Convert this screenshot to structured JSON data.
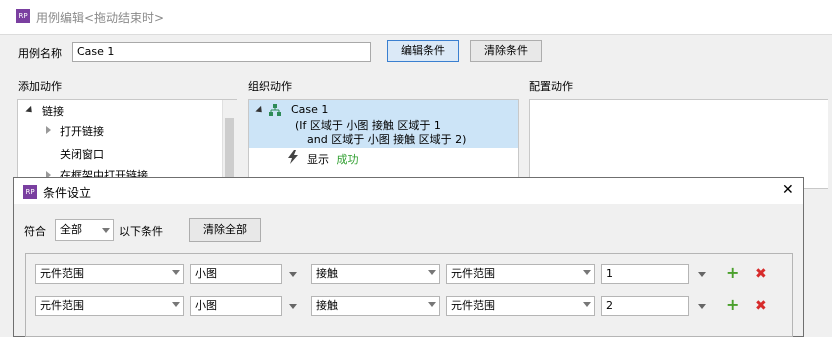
{
  "window": {
    "title": "用例编辑<拖动结束时>",
    "logo": "RP"
  },
  "case_name": {
    "label": "用例名称",
    "value": "Case 1"
  },
  "toolbar": {
    "edit_condition": "编辑条件",
    "clear_condition": "清除条件"
  },
  "sections": {
    "add_action": "添加动作",
    "organize_action": "组织动作",
    "configure_action": "配置动作"
  },
  "add_action_tree": {
    "link_group": "链接",
    "items": [
      "打开链接",
      "关闭窗口",
      "在框架中打开链接"
    ]
  },
  "organize_tree": {
    "case_title": "Case 1",
    "condition_line1": "(If 区域于 小图 接触 区域于 1",
    "condition_line2": "and 区域于 小图 接触 区域于 2)",
    "action_prefix": "显示",
    "action_target": "成功"
  },
  "dialog": {
    "logo": "RP",
    "title": "条件设立",
    "match_label": "符合",
    "match_value": "全部",
    "match_suffix": "以下条件",
    "clear_all": "清除全部",
    "close_symbol": "✕"
  },
  "conditions": [
    {
      "scope": "元件范围",
      "widget": "小图",
      "operator": "接触",
      "target_scope": "元件范围",
      "target_value": "1"
    },
    {
      "scope": "元件范围",
      "widget": "小图",
      "operator": "接触",
      "target_scope": "元件范围",
      "target_value": "2"
    }
  ],
  "colors": {
    "accent": "#3a7fd0",
    "brand": "#7a3fa0",
    "selection": "#cce4f7",
    "success_text": "#2e9e2e",
    "add": "#4aa02c",
    "delete": "#d72b2b"
  }
}
